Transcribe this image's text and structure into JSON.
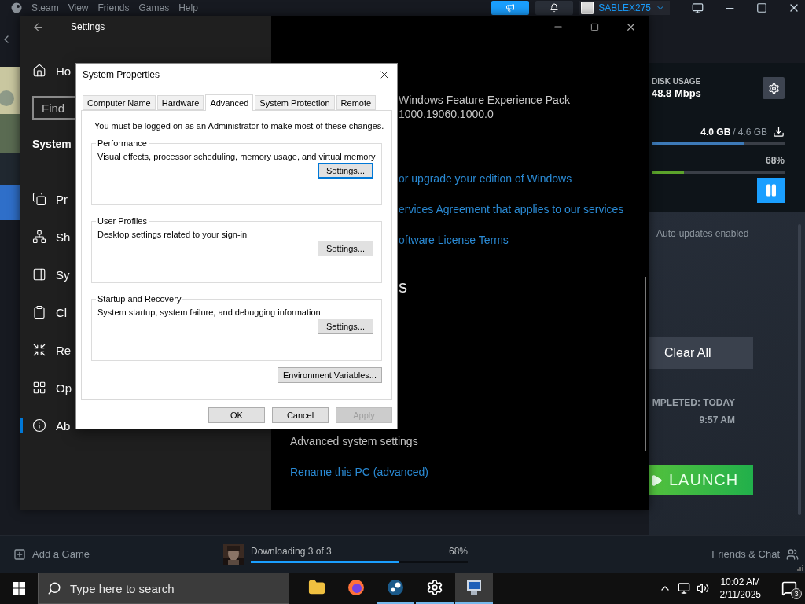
{
  "steam": {
    "menu": [
      "Steam",
      "View",
      "Friends",
      "Games",
      "Help"
    ],
    "account": {
      "name": "SABLEX275"
    },
    "downloads": {
      "disk_usage_label": "DISK USAGE",
      "disk_usage": "48.8 Mbps",
      "downloaded": "4.0 GB",
      "separator": "/",
      "total": "4.6 GB",
      "size_progress": {
        "level": 0.69
      },
      "percent": "68%",
      "percent_progress": {
        "level": 0.24
      }
    },
    "queue": {
      "auto_updates": "Auto-updates enabled",
      "clear_button": "Clear All",
      "completed_label": "MPLETED: TODAY",
      "completed_time": "9:57 AM",
      "launch_button": "LAUNCH"
    },
    "bottom_bar": {
      "add_game": "Add a Game",
      "status": "Downloading 3 of 3",
      "percent": "68%",
      "progress": {
        "level": 0.68
      },
      "friends": "Friends & Chat"
    }
  },
  "settings": {
    "title": "Settings",
    "home": {
      "label": "Ho"
    },
    "search": {
      "placeholder": "Find"
    },
    "section": "System",
    "nav": [
      {
        "label": "Pr",
        "kind": "projecting",
        "selected": false
      },
      {
        "label": "Sh",
        "kind": "sharing",
        "selected": false
      },
      {
        "label": "Sy",
        "kind": "panel",
        "selected": false
      },
      {
        "label": "Cl",
        "kind": "clipboard",
        "selected": false
      },
      {
        "label": "Re",
        "kind": "remote",
        "selected": false
      },
      {
        "label": "Op",
        "kind": "features",
        "selected": false
      },
      {
        "label": "Ab",
        "kind": "about",
        "selected": true
      }
    ],
    "details": [
      {
        "text": "Windows Feature Experience Pack",
        "kind": "value"
      },
      {
        "text": "1000.19060.1000.0",
        "kind": "value"
      },
      {
        "text": "or upgrade your edition of Windows",
        "kind": "link"
      },
      {
        "text": "ervices Agreement that applies to our services",
        "kind": "link"
      },
      {
        "text": "oftware License Terms",
        "kind": "link"
      },
      {
        "text": "s",
        "kind": "heading"
      }
    ],
    "related": [
      {
        "text": "Advanced system settings",
        "kind": "plain"
      },
      {
        "text": "Rename this PC (advanced)",
        "kind": "link"
      }
    ]
  },
  "dialog": {
    "title": "System Properties",
    "tabs": [
      {
        "label": "Computer Name",
        "selected": false
      },
      {
        "label": "Hardware",
        "selected": false
      },
      {
        "label": "Advanced",
        "selected": true
      },
      {
        "label": "System Protection",
        "selected": false
      },
      {
        "label": "Remote",
        "selected": false
      }
    ],
    "notice": "You must be logged on as an Administrator to make most of these changes.",
    "groups": [
      {
        "legend": "Performance",
        "description": "Visual effects, processor scheduling, memory usage, and virtual memory",
        "button": {
          "label": "Settings...",
          "focused": true
        }
      },
      {
        "legend": "User Profiles",
        "description": "Desktop settings related to your sign-in",
        "button": {
          "label": "Settings...",
          "focused": false
        }
      },
      {
        "legend": "Startup and Recovery",
        "description": "System startup, system failure, and debugging information",
        "button": {
          "label": "Settings...",
          "focused": false
        }
      }
    ],
    "environment_button": "Environment Variables...",
    "buttons": [
      {
        "label": "OK",
        "disabled": false
      },
      {
        "label": "Cancel",
        "disabled": false
      },
      {
        "label": "Apply",
        "disabled": true
      }
    ]
  },
  "taskbar": {
    "search": {
      "placeholder": "Type here to search"
    },
    "apps": [
      {
        "kind": "folder",
        "running": false,
        "active": false
      },
      {
        "kind": "firefox",
        "running": false,
        "active": false
      },
      {
        "kind": "steam",
        "running": true,
        "active": false
      },
      {
        "kind": "settings",
        "running": true,
        "active": false
      },
      {
        "kind": "system",
        "running": true,
        "active": true
      }
    ],
    "time": "10:02 AM",
    "date": "2/11/2025",
    "notifications": "3"
  }
}
